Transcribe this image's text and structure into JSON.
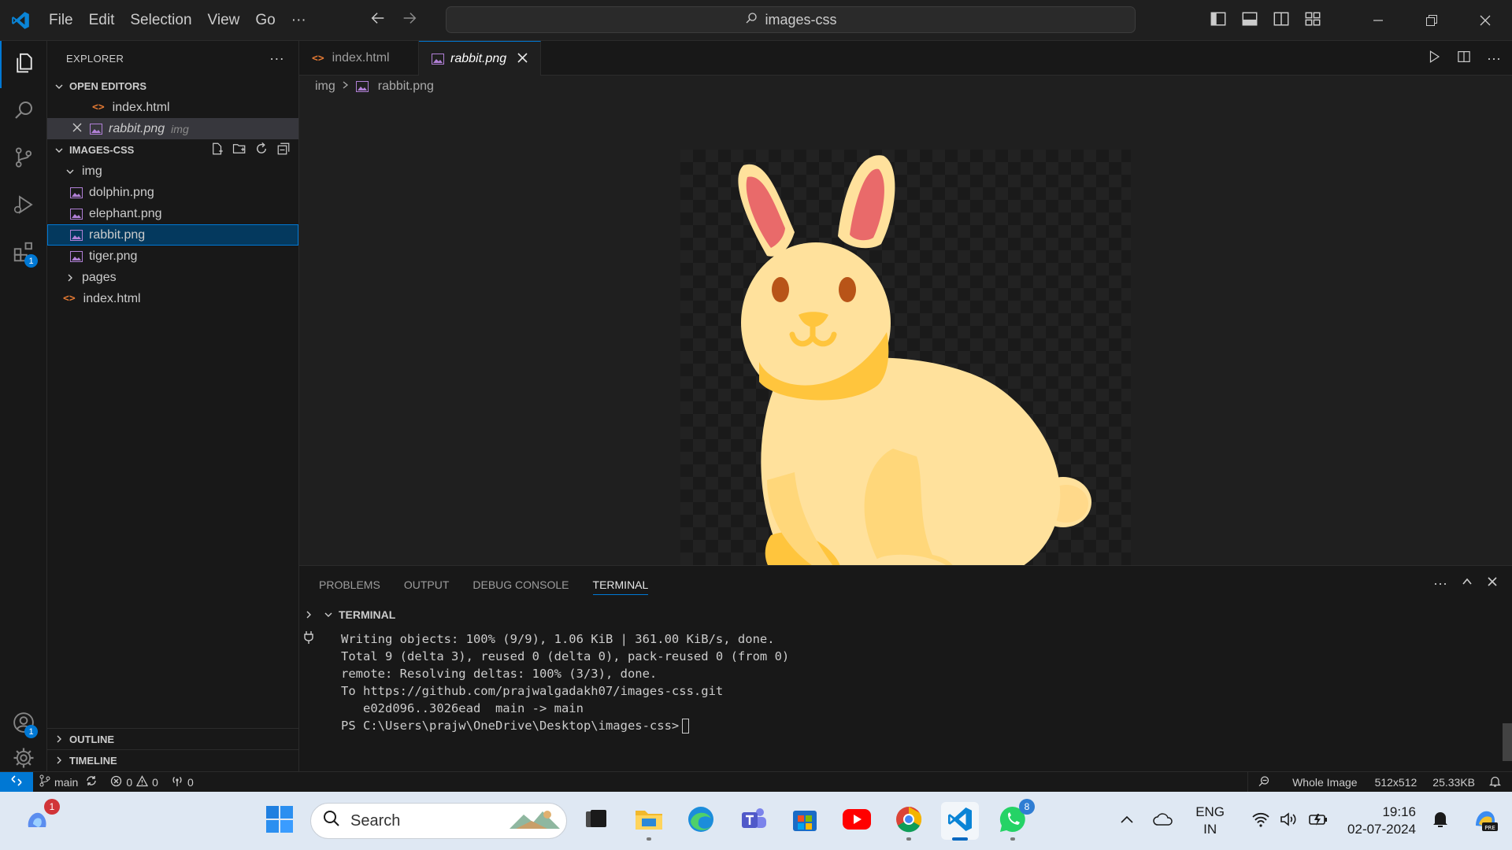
{
  "titlebar": {
    "menu": [
      "File",
      "Edit",
      "Selection",
      "View",
      "Go"
    ],
    "more": "···",
    "search_text": "images-css"
  },
  "activity": {
    "extensions_badge": "1",
    "accounts_badge": "1"
  },
  "sidebar": {
    "title": "EXPLORER",
    "more": "···",
    "open_editors_label": "OPEN EDITORS",
    "open_editors": [
      {
        "name": "index.html",
        "type": "html"
      },
      {
        "name": "rabbit.png",
        "type": "image",
        "folder": "img"
      }
    ],
    "project_label": "IMAGES-CSS",
    "tree": {
      "img_folder": "img",
      "img_files": [
        "dolphin.png",
        "elephant.png",
        "rabbit.png",
        "tiger.png"
      ],
      "pages_folder": "pages",
      "index_file": "index.html"
    },
    "outline_label": "OUTLINE",
    "timeline_label": "TIMELINE"
  },
  "editor": {
    "tabs": [
      {
        "label": "index.html",
        "type": "html"
      },
      {
        "label": "rabbit.png",
        "type": "image",
        "active": true
      }
    ],
    "breadcrumb": [
      "img",
      "rabbit.png"
    ]
  },
  "panel": {
    "tabs": [
      "PROBLEMS",
      "OUTPUT",
      "DEBUG CONSOLE",
      "TERMINAL"
    ],
    "active_tab": "TERMINAL",
    "terminal_label": "TERMINAL",
    "terminal_lines": [
      "Writing objects: 100% (9/9), 1.06 KiB | 361.00 KiB/s, done.",
      "Total 9 (delta 3), reused 0 (delta 0), pack-reused 0 (from 0)",
      "remote: Resolving deltas: 100% (3/3), done.",
      "To https://github.com/prajwalgadakh07/images-css.git",
      "   e02d096..3026ead  main -> main"
    ],
    "prompt": "PS C:\\Users\\prajw\\OneDrive\\Desktop\\images-css>"
  },
  "statusbar": {
    "branch": "main",
    "errors": "0",
    "warnings": "0",
    "ports": "0",
    "zoom_label": "Whole Image",
    "dimensions": "512x512",
    "filesize": "25.33KB"
  },
  "taskbar": {
    "search_placeholder": "Search",
    "copilot_badge": "1",
    "whatsapp_badge": "8",
    "lang_top": "ENG",
    "lang_bottom": "IN",
    "time": "19:16",
    "date": "02-07-2024"
  },
  "colors": {
    "accent": "#0078d4",
    "html_icon": "#e37933",
    "image_icon": "#b180d7"
  }
}
